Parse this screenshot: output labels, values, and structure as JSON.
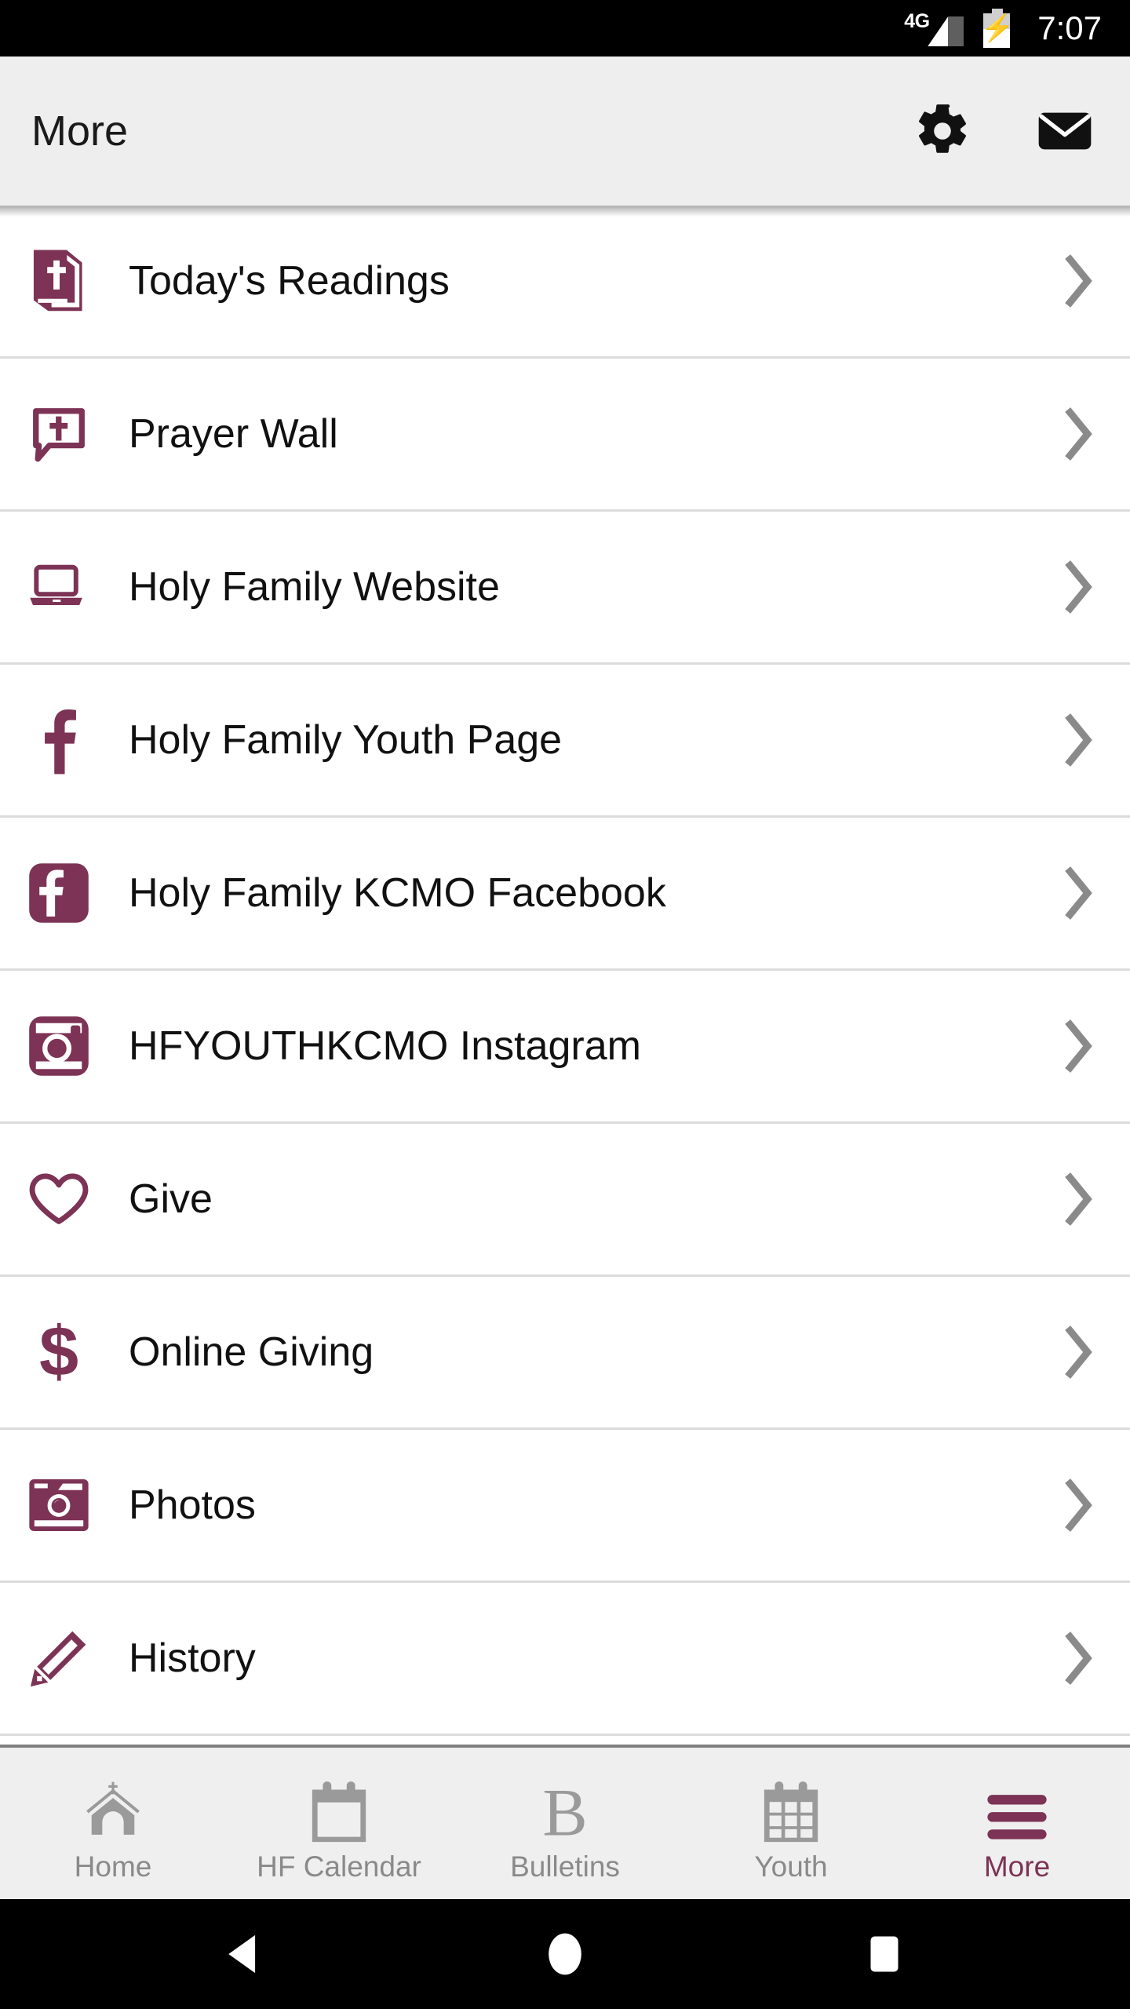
{
  "theme": {
    "accent": "#7D3355",
    "header_bg": "#eeeeee",
    "tabbar_bg": "#efefef",
    "divider": "#dcdcdc",
    "chevron": "#8a8a8a",
    "tab_inactive": "#8a8a8a",
    "statusbar_bg": "#000000",
    "navbar_bg": "#000000"
  },
  "statusbar": {
    "network": "4G",
    "signal_icon": "signal-bars-icon",
    "battery_icon": "battery-charging-icon",
    "time": "7:07"
  },
  "header": {
    "title": "More",
    "actions": [
      {
        "name": "settings-button",
        "icon": "gear-icon"
      },
      {
        "name": "mail-button",
        "icon": "envelope-icon"
      }
    ]
  },
  "list": {
    "chevron_icon": "chevron-right-icon",
    "items": [
      {
        "label": "Today's Readings",
        "icon": "bible-cross-icon"
      },
      {
        "label": "Prayer Wall",
        "icon": "speech-bubble-cross-icon"
      },
      {
        "label": "Holy Family Website",
        "icon": "laptop-icon"
      },
      {
        "label": "Holy Family Youth Page",
        "icon": "facebook-f-icon"
      },
      {
        "label": "Holy Family KCMO Facebook",
        "icon": "facebook-badge-icon"
      },
      {
        "label": "HFYOUTHKCMO Instagram",
        "icon": "instagram-badge-icon"
      },
      {
        "label": "Give",
        "icon": "heart-outline-icon"
      },
      {
        "label": "Online Giving",
        "icon": "dollar-sign-icon"
      },
      {
        "label": "Photos",
        "icon": "camera-badge-icon"
      },
      {
        "label": "History",
        "icon": "pencil-icon"
      }
    ]
  },
  "tabbar": {
    "tabs": [
      {
        "label": "Home",
        "icon": "church-icon",
        "active": false
      },
      {
        "label": "HF Calendar",
        "icon": "calendar-icon",
        "active": false
      },
      {
        "label": "Bulletins",
        "icon": "letter-b-icon",
        "active": false
      },
      {
        "label": "Youth",
        "icon": "calendar-grid-icon",
        "active": false
      },
      {
        "label": "More",
        "icon": "hamburger-menu-icon",
        "active": true
      }
    ]
  },
  "navbar": {
    "buttons": [
      {
        "name": "back-button",
        "icon": "triangle-back-icon"
      },
      {
        "name": "home-button",
        "icon": "circle-home-icon"
      },
      {
        "name": "recents-button",
        "icon": "square-recents-icon"
      }
    ]
  }
}
